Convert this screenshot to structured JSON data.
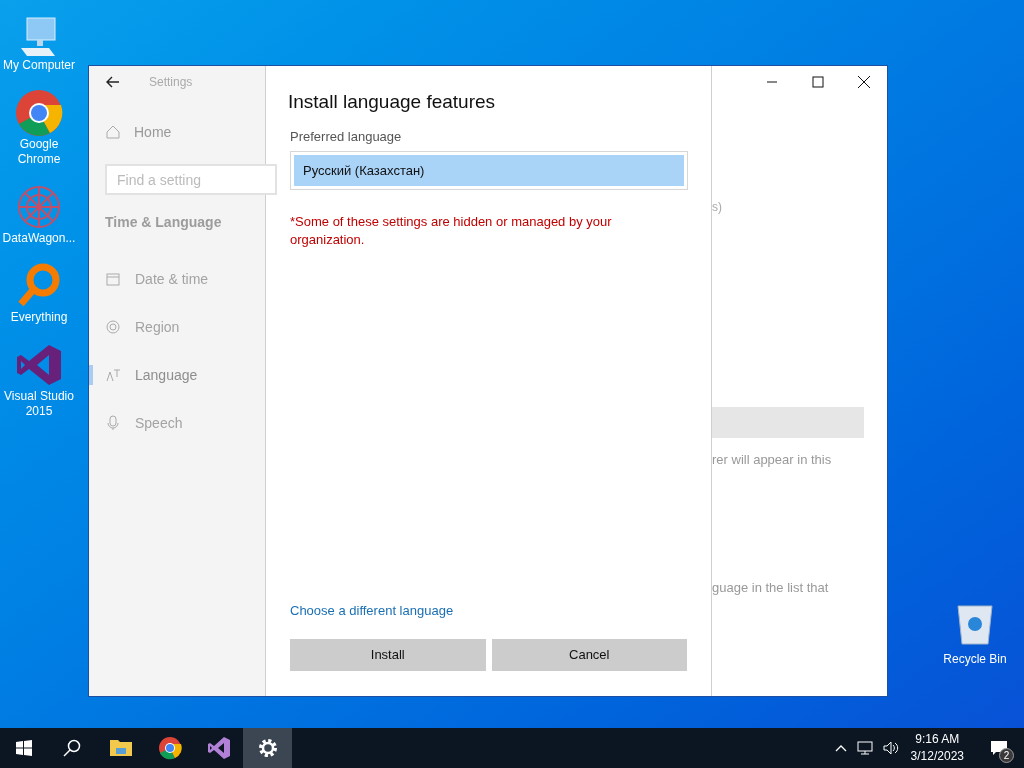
{
  "desktop_icons": [
    {
      "kind": "computer",
      "label": "My Computer"
    },
    {
      "kind": "chrome",
      "label": "Google Chrome"
    },
    {
      "kind": "datawagon",
      "label": "DataWagon..."
    },
    {
      "kind": "everything",
      "label": "Everything"
    },
    {
      "kind": "vs",
      "label": "Visual Studio 2015"
    }
  ],
  "recycle_bin": {
    "label": "Recycle Bin"
  },
  "window": {
    "title": "Settings",
    "search_placeholder": "Find a setting",
    "home": "Home",
    "section": "Time & Language",
    "nav": [
      {
        "kind": "date",
        "label": "Date & time",
        "selected": false
      },
      {
        "kind": "region",
        "label": "Region",
        "selected": false
      },
      {
        "kind": "language",
        "label": "Language",
        "selected": true
      },
      {
        "kind": "speech",
        "label": "Speech",
        "selected": false
      }
    ],
    "background_texts": [
      "s)",
      "rer will appear in this",
      "guage in the list that"
    ]
  },
  "dialog": {
    "title": "Install language features",
    "field_label": "Preferred language",
    "selected_language": "Русский (Казахстан)",
    "warning": "*Some of these settings are hidden or managed by your organization.",
    "link": "Choose a different language",
    "buttons": [
      "Install",
      "Cancel"
    ]
  },
  "taskbar": {
    "apps": [
      {
        "kind": "explorer",
        "active": false
      },
      {
        "kind": "chrome",
        "active": false
      },
      {
        "kind": "vs",
        "active": false
      },
      {
        "kind": "settings",
        "active": true
      }
    ],
    "time": "9:16 AM",
    "date": "3/12/2023",
    "notifications": "2"
  }
}
